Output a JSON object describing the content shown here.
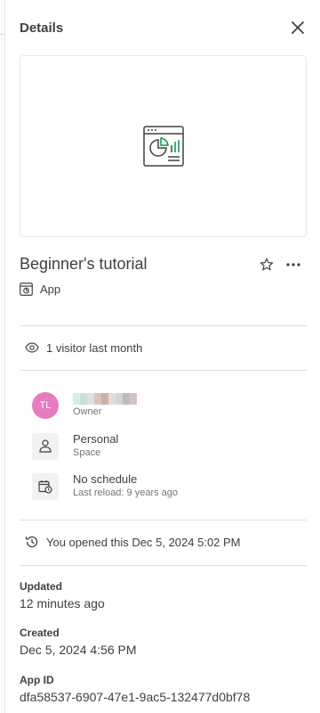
{
  "header": {
    "title": "Details"
  },
  "app": {
    "title": "Beginner's tutorial",
    "type_label": "App"
  },
  "visitors": {
    "text": "1 visitor last month"
  },
  "owner": {
    "initials": "TL",
    "role_label": "Owner",
    "avatar_color": "#e77bc0",
    "name_pixels": [
      "#d9ecec",
      "#c9dede",
      "#e0e0e0",
      "#d8c6bd",
      "#c9b2a6",
      "#e6dcd6",
      "#d5d5d5",
      "#bcbcbc",
      "#d2c3cb"
    ]
  },
  "space": {
    "value": "Personal",
    "label": "Space"
  },
  "schedule": {
    "value": "No schedule",
    "detail": "Last reload: 9 years ago"
  },
  "history": {
    "text": "You opened this Dec 5, 2024 5:02 PM"
  },
  "meta": {
    "updated_label": "Updated",
    "updated_value": "12 minutes ago",
    "created_label": "Created",
    "created_value": "Dec 5, 2024 4:56 PM",
    "appid_label": "App ID",
    "appid_value": "dfa58537-6907-47e1-9ac5-132477d0bf78"
  },
  "icons": {
    "close": "close-icon",
    "thumbnail": "app-chart-icon",
    "star": "star-icon",
    "more": "more-horizontal-icon",
    "type": "app-icon",
    "visitors": "eye-icon",
    "space": "person-icon",
    "schedule": "calendar-clock-icon",
    "history": "history-icon"
  },
  "colors": {
    "text": "#404040",
    "secondary_text": "#737373",
    "divider": "#e0e0e0",
    "chart_green": "#009845"
  }
}
